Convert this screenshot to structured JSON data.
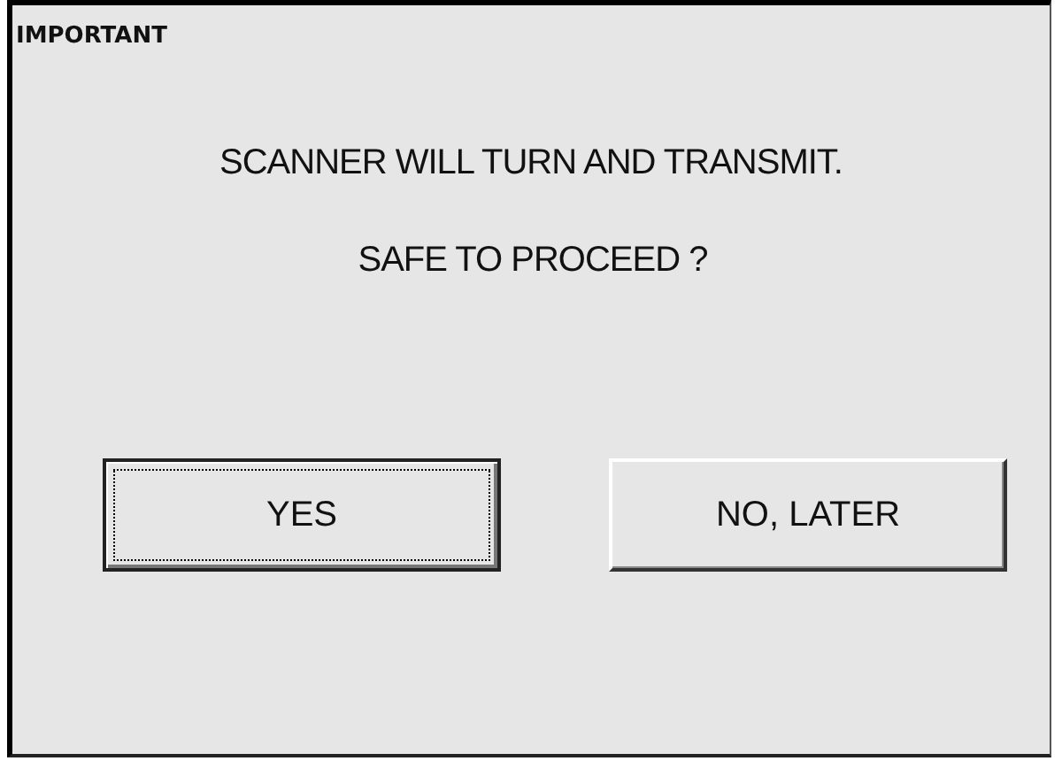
{
  "window": {
    "title": "IMPORTANT"
  },
  "message": [
    "SCANNER WILL TURN AND TRANSMIT.",
    "SAFE TO PROCEED ?"
  ],
  "buttons": [
    {
      "label": "YES",
      "focused": true
    },
    {
      "label": "NO, LATER",
      "focused": false
    }
  ]
}
